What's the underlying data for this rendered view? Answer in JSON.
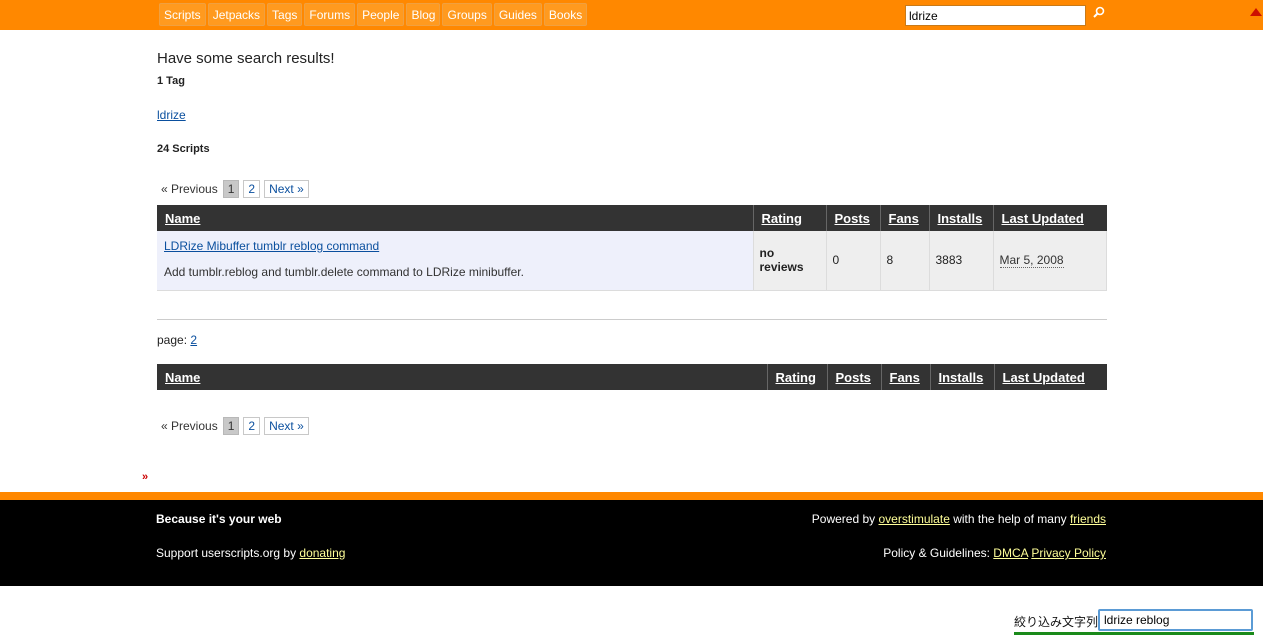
{
  "topbar": {
    "nav": [
      "Scripts",
      "Jetpacks",
      "Tags",
      "Forums",
      "People",
      "Blog",
      "Groups",
      "Guides",
      "Books"
    ],
    "search_value": "ldrize",
    "search_icon": "magnifier-icon",
    "scroll_icon": "triangle-up-icon",
    "accent": "#ff8800"
  },
  "main": {
    "title": "Have some search results!",
    "tags_heading": "1 Tag",
    "tag_link": "ldrize",
    "scripts_heading": "24 Scripts",
    "pager": {
      "prev": "« Previous",
      "current": "1",
      "page2": "2",
      "next": "Next »"
    },
    "table": {
      "headers": {
        "name": "Name",
        "rating": "Rating",
        "posts": "Posts",
        "fans": "Fans",
        "installs": "Installs",
        "updated": "Last Updated"
      },
      "rows": [
        {
          "title": "LDRize Mibuffer tumblr reblog command",
          "description": "Add tumblr.reblog and tumblr.delete command to LDRize minibuffer.",
          "rating": "no reviews",
          "posts": "0",
          "fans": "8",
          "installs": "3883",
          "updated": "Mar 5, 2008"
        }
      ]
    },
    "page_label": "page:",
    "page_link": "2"
  },
  "footer": {
    "tagline": "Because it's your web",
    "support_prefix": "Support userscripts.org by",
    "support_link": "donating",
    "powered_prefix": "Powered by",
    "powered_link": "overstimulate",
    "powered_middle": "with the help of many",
    "friends_link": "friends",
    "policy_prefix": "Policy & Guidelines:",
    "dmca_link": "DMCA",
    "privacy_link": "Privacy Policy"
  },
  "filter": {
    "label": "絞り込み文字列:",
    "value": "ldrize reblog"
  }
}
